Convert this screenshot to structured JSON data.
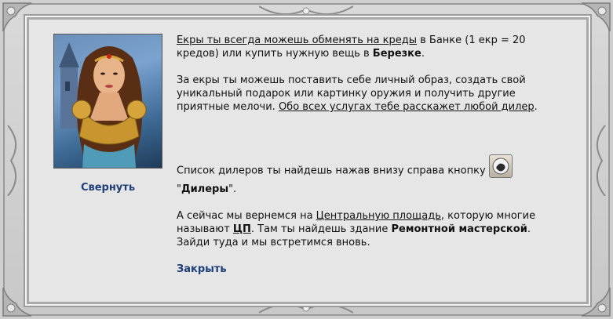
{
  "portrait": {
    "alt": "character-portrait"
  },
  "collapse_label": "Свернуть",
  "close_label": "Закрыть",
  "para1": {
    "link": "Екры ты всегда можешь обменять на креды",
    "text1": " в Банке (1 екр = 20 кредов) или купить нужную вещь в ",
    "bold": "Березке",
    "text2": "."
  },
  "para2": {
    "text1": "За екры ты можешь поставить себе личный образ, создать свой уникальный подарок или картинку оружия и получить другие приятные мелочи. ",
    "link": "Обо всех услугах тебе расскажет любой дилер",
    "text2": "."
  },
  "para3": {
    "text1": "Список дилеров ты найдешь нажав внизу справа кнопку ",
    "quote_open": "\"",
    "bold": "Дилеры",
    "quote_close": "\"."
  },
  "para4": {
    "text1": "А сейчас мы вернемся на ",
    "link": "Центральную площадь",
    "text2": ", которую многие называют ",
    "link_bold": "ЦП",
    "text3": ". Там ты найдешь здание ",
    "bold": "Ремонтной мастерской",
    "text4": ". Зайди туда и мы встретимся вновь."
  },
  "colors": {
    "link": "#1f3f7a",
    "panel": "#e6e6e6",
    "frame": "#cfcfcf"
  }
}
